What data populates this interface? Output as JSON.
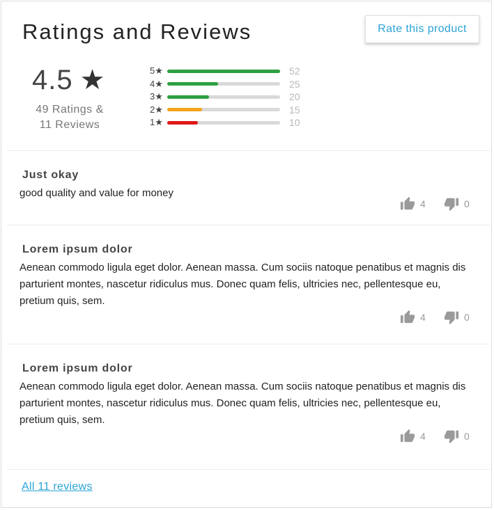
{
  "header": {
    "title": "Ratings and Reviews",
    "rate_button": "Rate this product"
  },
  "summary": {
    "average": "4.5",
    "star_glyph": "★",
    "ratings_line": "49 Ratings &",
    "reviews_line": "11 Reviews"
  },
  "distribution": [
    {
      "label": "5★",
      "count": "52",
      "fraction": 1.0,
      "color": "#2ea043"
    },
    {
      "label": "4★",
      "count": "25",
      "fraction": 0.45,
      "color": "#2ea043"
    },
    {
      "label": "3★",
      "count": "20",
      "fraction": 0.37,
      "color": "#2ea043"
    },
    {
      "label": "2★",
      "count": "15",
      "fraction": 0.31,
      "color": "#f4a31a"
    },
    {
      "label": "1★",
      "count": "10",
      "fraction": 0.27,
      "color": "#e01818"
    }
  ],
  "reviews": [
    {
      "title": "Just okay",
      "body": "good quality and value for money",
      "up": "4",
      "down": "0"
    },
    {
      "title": "Lorem ipsum dolor",
      "body": "Aenean commodo ligula eget dolor. Aenean massa. Cum sociis natoque penatibus et magnis dis parturient montes, nascetur ridiculus mus. Donec quam felis, ultricies nec, pellentesque eu, pretium quis, sem.",
      "up": "4",
      "down": "0"
    },
    {
      "title": "Lorem ipsum dolor",
      "body": "Aenean commodo ligula eget dolor. Aenean massa. Cum sociis natoque penatibus et magnis dis parturient montes, nascetur ridiculus mus. Donec quam felis, ultricies nec, pellentesque eu, pretium quis, sem.",
      "up": "4",
      "down": "0"
    }
  ],
  "footer": {
    "all_reviews_link": "All 11 reviews"
  },
  "icons": {
    "thumb_up": "thumbs-up-icon",
    "thumb_down": "thumbs-down-icon"
  },
  "colors": {
    "accent": "#2aa3d6",
    "vote_icon": "#9a9a9a"
  }
}
